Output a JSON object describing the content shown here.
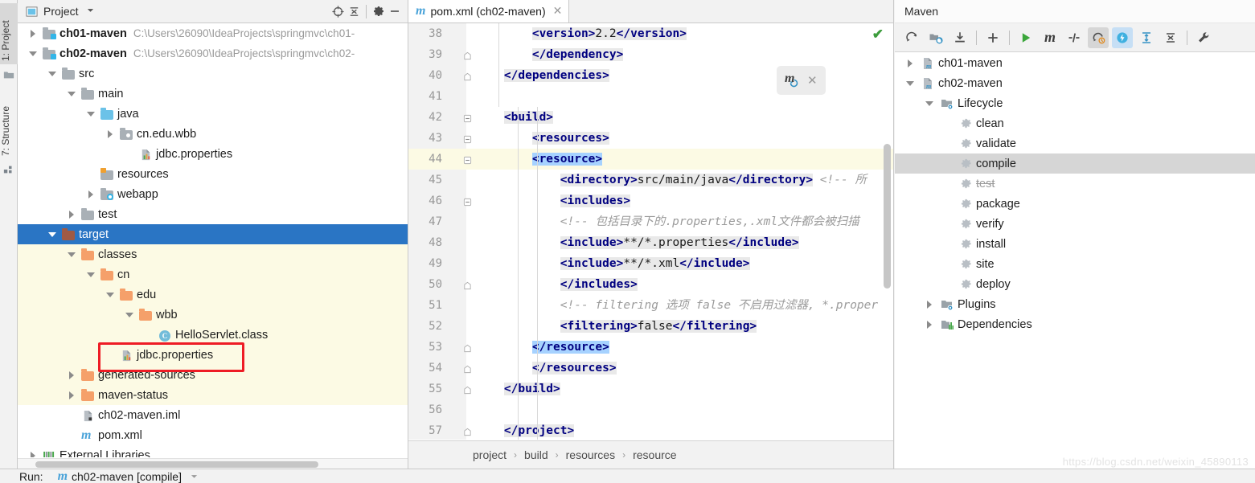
{
  "toolwindow_tabs": [
    {
      "label": "1: Project",
      "icon": "project-folder-icon",
      "selected": true
    },
    {
      "label": "7: Structure",
      "icon": "structure-icon",
      "selected": false
    }
  ],
  "project_panel": {
    "title": "Project",
    "dropdown_icon": "chevron-down-icon",
    "toolbar": [
      {
        "name": "locate-icon",
        "glyph": "target"
      },
      {
        "name": "collapse-all-icon",
        "glyph": "collapse"
      },
      {
        "name": "settings-gear-icon",
        "glyph": "gear"
      },
      {
        "name": "hide-panel-icon",
        "glyph": "minus"
      }
    ],
    "tree": [
      {
        "label": "ch01-maven",
        "path": "C:\\Users\\26090\\IdeaProjects\\springmvc\\ch01-",
        "indent": 0,
        "arrow": "right",
        "icon": "module-folder-icon",
        "bold": true
      },
      {
        "label": "ch02-maven",
        "path": "C:\\Users\\26090\\IdeaProjects\\springmvc\\ch02-",
        "indent": 0,
        "arrow": "down",
        "icon": "module-folder-icon",
        "bold": true
      },
      {
        "label": "src",
        "path": "",
        "indent": 1,
        "arrow": "down",
        "icon": "folder-gray-icon",
        "bold": false
      },
      {
        "label": "main",
        "path": "",
        "indent": 2,
        "arrow": "down",
        "icon": "folder-gray-icon",
        "bold": false
      },
      {
        "label": "java",
        "path": "",
        "indent": 3,
        "arrow": "down",
        "icon": "folder-source-blue-icon",
        "bold": false
      },
      {
        "label": "cn.edu.wbb",
        "path": "",
        "indent": 4,
        "arrow": "right",
        "icon": "package-icon",
        "bold": false
      },
      {
        "label": "jdbc.properties",
        "path": "",
        "indent": 5,
        "arrow": "none",
        "icon": "properties-file-icon",
        "bold": false
      },
      {
        "label": "resources",
        "path": "",
        "indent": 3,
        "arrow": "none",
        "icon": "folder-resources-icon",
        "bold": false
      },
      {
        "label": "webapp",
        "path": "",
        "indent": 3,
        "arrow": "right",
        "icon": "folder-webapp-icon",
        "bold": false
      },
      {
        "label": "test",
        "path": "",
        "indent": 2,
        "arrow": "right",
        "icon": "folder-gray-icon",
        "bold": false
      },
      {
        "label": "target",
        "path": "",
        "indent": 1,
        "arrow": "down",
        "icon": "folder-excluded-icon",
        "bold": false,
        "selected": true
      },
      {
        "label": "classes",
        "path": "",
        "indent": 2,
        "arrow": "down",
        "icon": "folder-orange-icon",
        "bold": false,
        "yellow": true
      },
      {
        "label": "cn",
        "path": "",
        "indent": 3,
        "arrow": "down",
        "icon": "folder-orange-icon",
        "bold": false,
        "yellow": true
      },
      {
        "label": "edu",
        "path": "",
        "indent": 4,
        "arrow": "down",
        "icon": "folder-orange-icon",
        "bold": false,
        "yellow": true
      },
      {
        "label": "wbb",
        "path": "",
        "indent": 5,
        "arrow": "down",
        "icon": "folder-orange-icon",
        "bold": false,
        "yellow": true
      },
      {
        "label": "HelloServlet.class",
        "path": "",
        "indent": 6,
        "arrow": "none",
        "icon": "class-file-icon",
        "bold": false,
        "yellow": true
      },
      {
        "label": "jdbc.properties",
        "path": "",
        "indent": 4,
        "arrow": "none",
        "icon": "properties-file-icon",
        "bold": false,
        "yellow": true,
        "highlighted": true
      },
      {
        "label": "generated-sources",
        "path": "",
        "indent": 2,
        "arrow": "right",
        "icon": "folder-orange-icon",
        "bold": false,
        "yellow": true
      },
      {
        "label": "maven-status",
        "path": "",
        "indent": 2,
        "arrow": "right",
        "icon": "folder-orange-icon",
        "bold": false,
        "yellow": true
      },
      {
        "label": "ch02-maven.iml",
        "path": "",
        "indent": 2,
        "arrow": "none",
        "icon": "iml-file-icon",
        "bold": false
      },
      {
        "label": "pom.xml",
        "path": "",
        "indent": 2,
        "arrow": "none",
        "icon": "maven-pom-icon",
        "bold": false
      },
      {
        "label": "External Libraries",
        "path": "",
        "indent": 0,
        "arrow": "right",
        "icon": "library-icon",
        "bold": false
      }
    ]
  },
  "editor": {
    "tab": {
      "label": "pom.xml (ch02-maven)",
      "icon": "maven-pom-icon",
      "close_icon": "close-icon"
    },
    "inspection_status_icon": "check-ok-icon",
    "maven_popup": {
      "reload_icon": "maven-reload-icon",
      "close_icon": "close-icon"
    },
    "lines": [
      {
        "num": "38",
        "indent": 5,
        "fold": "none",
        "current": false,
        "segments": [
          {
            "t": "<version>",
            "c": "tagname hl"
          },
          {
            "t": "2.2",
            "c": "val hl"
          },
          {
            "t": "</version>",
            "c": "tagname hl"
          }
        ]
      },
      {
        "num": "39",
        "indent": 4,
        "fold": "end",
        "current": false,
        "segments": [
          {
            "t": "</dependency>",
            "c": "tagname hl"
          }
        ]
      },
      {
        "num": "40",
        "indent": 3,
        "fold": "end",
        "current": false,
        "segments": [
          {
            "t": "</dependencies>",
            "c": "tagname hl"
          }
        ]
      },
      {
        "num": "41",
        "indent": 0,
        "fold": "none",
        "current": false,
        "segments": []
      },
      {
        "num": "42",
        "indent": 3,
        "fold": "start",
        "current": false,
        "segments": [
          {
            "t": "<build>",
            "c": "tagname hl"
          }
        ]
      },
      {
        "num": "43",
        "indent": 4,
        "fold": "start",
        "current": false,
        "segments": [
          {
            "t": "<resources>",
            "c": "tagname hl"
          }
        ]
      },
      {
        "num": "44",
        "indent": 5,
        "fold": "start",
        "current": true,
        "segments": [
          {
            "t": "<resource>",
            "c": "tagname selblue"
          }
        ]
      },
      {
        "num": "45",
        "indent": 6,
        "fold": "none",
        "current": false,
        "segments": [
          {
            "t": "<directory>",
            "c": "tagname hl"
          },
          {
            "t": "src/main/java",
            "c": "val hl"
          },
          {
            "t": "</directory>",
            "c": "tagname hl"
          },
          {
            "t": " ",
            "c": ""
          },
          {
            "t": "<!-- 所",
            "c": "cmt"
          }
        ]
      },
      {
        "num": "46",
        "indent": 6,
        "fold": "start",
        "current": false,
        "segments": [
          {
            "t": "<includes>",
            "c": "tagname hl"
          }
        ]
      },
      {
        "num": "47",
        "indent": 7,
        "fold": "none",
        "current": false,
        "segments": [
          {
            "t": "<!-- 包括目录下的.properties,.xml文件都会被扫描",
            "c": "cmt"
          }
        ]
      },
      {
        "num": "48",
        "indent": 7,
        "fold": "none",
        "current": false,
        "segments": [
          {
            "t": "<include>",
            "c": "tagname hl"
          },
          {
            "t": "**/*.properties",
            "c": "val hl"
          },
          {
            "t": "</include>",
            "c": "tagname hl"
          }
        ]
      },
      {
        "num": "49",
        "indent": 7,
        "fold": "none",
        "current": false,
        "segments": [
          {
            "t": "<include>",
            "c": "tagname hl"
          },
          {
            "t": "**/*.xml",
            "c": "val hl"
          },
          {
            "t": "</include>",
            "c": "tagname hl"
          }
        ]
      },
      {
        "num": "50",
        "indent": 6,
        "fold": "end",
        "current": false,
        "segments": [
          {
            "t": "</includes>",
            "c": "tagname hl"
          }
        ]
      },
      {
        "num": "51",
        "indent": 6,
        "fold": "none",
        "current": false,
        "segments": [
          {
            "t": "<!-- filtering 选项 false 不启用过滤器, *.proper",
            "c": "cmt"
          }
        ]
      },
      {
        "num": "52",
        "indent": 6,
        "fold": "none",
        "current": false,
        "segments": [
          {
            "t": "<filtering>",
            "c": "tagname hl"
          },
          {
            "t": "false",
            "c": "val hl"
          },
          {
            "t": "</filtering>",
            "c": "tagname hl"
          }
        ]
      },
      {
        "num": "53",
        "indent": 5,
        "fold": "end",
        "current": false,
        "segments": [
          {
            "t": "</resource>",
            "c": "tagname selblue"
          }
        ]
      },
      {
        "num": "54",
        "indent": 4,
        "fold": "end",
        "current": false,
        "segments": [
          {
            "t": "</resources>",
            "c": "tagname hl"
          }
        ]
      },
      {
        "num": "55",
        "indent": 3,
        "fold": "end",
        "current": false,
        "segments": [
          {
            "t": "</build>",
            "c": "tagname hl"
          }
        ]
      },
      {
        "num": "56",
        "indent": 0,
        "fold": "none",
        "current": false,
        "segments": []
      },
      {
        "num": "57",
        "indent": 2,
        "fold": "end",
        "current": false,
        "segments": [
          {
            "t": "</project>",
            "c": "tagname hl"
          }
        ]
      }
    ],
    "breadcrumb": [
      "project",
      "build",
      "resources",
      "resource"
    ],
    "breadcrumb_separator": "›"
  },
  "maven_panel": {
    "title": "Maven",
    "toolbar": [
      {
        "name": "reload-all-projects-icon",
        "glyph": "reload",
        "state": "normal"
      },
      {
        "name": "add-maven-project-icon",
        "glyph": "addproject",
        "state": "normal"
      },
      {
        "name": "download-sources-icon",
        "glyph": "download",
        "state": "normal"
      },
      {
        "name": "add-icon",
        "glyph": "plus",
        "state": "normal"
      },
      {
        "name": "run-build-icon",
        "glyph": "play",
        "state": "normal"
      },
      {
        "name": "execute-maven-goal-icon",
        "glyph": "m",
        "state": "normal"
      },
      {
        "name": "toggle-offline-mode-icon",
        "glyph": "offline",
        "state": "normal"
      },
      {
        "name": "toggle-skip-tests-icon",
        "glyph": "skiptests",
        "state": "toggled"
      },
      {
        "name": "show-dependencies-icon",
        "glyph": "bolt",
        "state": "active"
      },
      {
        "name": "expand-all-icon",
        "glyph": "expand",
        "state": "normal"
      },
      {
        "name": "collapse-all-icon",
        "glyph": "collapse",
        "state": "normal"
      },
      {
        "name": "maven-settings-icon",
        "glyph": "wrench",
        "state": "normal"
      }
    ],
    "tree": [
      {
        "label": "ch01-maven",
        "indent": 0,
        "arrow": "right",
        "icon": "maven-project-icon"
      },
      {
        "label": "ch02-maven",
        "indent": 0,
        "arrow": "down",
        "icon": "maven-project-icon"
      },
      {
        "label": "Lifecycle",
        "indent": 1,
        "arrow": "down",
        "icon": "lifecycle-folder-icon"
      },
      {
        "label": "clean",
        "indent": 2,
        "arrow": "none",
        "icon": "maven-goal-icon"
      },
      {
        "label": "validate",
        "indent": 2,
        "arrow": "none",
        "icon": "maven-goal-icon"
      },
      {
        "label": "compile",
        "indent": 2,
        "arrow": "none",
        "icon": "maven-goal-icon",
        "selected": true
      },
      {
        "label": "test",
        "indent": 2,
        "arrow": "none",
        "icon": "maven-goal-icon",
        "disabled": true
      },
      {
        "label": "package",
        "indent": 2,
        "arrow": "none",
        "icon": "maven-goal-icon"
      },
      {
        "label": "verify",
        "indent": 2,
        "arrow": "none",
        "icon": "maven-goal-icon"
      },
      {
        "label": "install",
        "indent": 2,
        "arrow": "none",
        "icon": "maven-goal-icon"
      },
      {
        "label": "site",
        "indent": 2,
        "arrow": "none",
        "icon": "maven-goal-icon"
      },
      {
        "label": "deploy",
        "indent": 2,
        "arrow": "none",
        "icon": "maven-goal-icon"
      },
      {
        "label": "Plugins",
        "indent": 1,
        "arrow": "right",
        "icon": "plugins-folder-icon"
      },
      {
        "label": "Dependencies",
        "indent": 1,
        "arrow": "right",
        "icon": "dependencies-folder-icon"
      }
    ]
  },
  "run_bar": {
    "label": "Run:",
    "config_name": "ch02-maven [compile]",
    "icon": "maven-pom-icon",
    "dropdown_icon": "chevron-down-icon"
  },
  "watermark": "https://blog.csdn.net/weixin_45890113",
  "colors": {
    "selection_blue": "#2a75c4",
    "code_selection": "#a6d2ff",
    "current_line": "#fcfae4",
    "excluded_yellow": "#fcfae4",
    "highlight_box_red": "#ee1c25",
    "accent_cyan": "#33b5e8",
    "maven_row_selected": "#d6d6d6",
    "ok_green": "#3c9c3c"
  }
}
